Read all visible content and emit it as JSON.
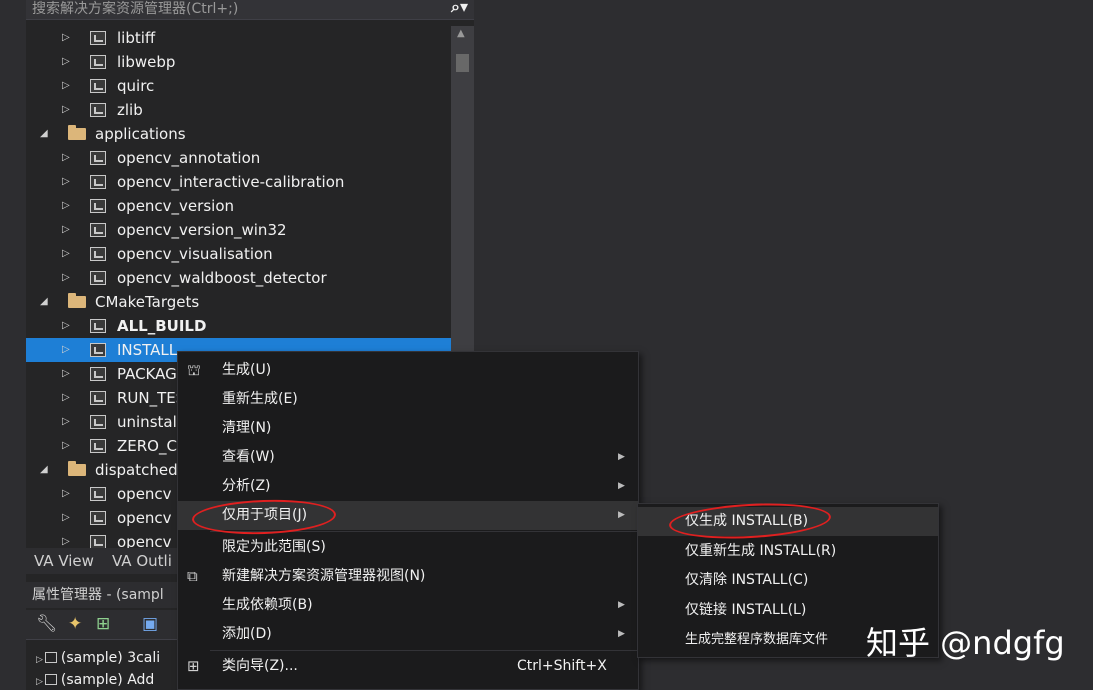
{
  "search": {
    "placeholder": "搜索解决方案资源管理器(Ctrl+;)",
    "icon": "search-icon"
  },
  "tree": [
    {
      "label": "libtiff",
      "type": "project",
      "level": 1,
      "expanded": false
    },
    {
      "label": "libwebp",
      "type": "project",
      "level": 1,
      "expanded": false
    },
    {
      "label": "quirc",
      "type": "project",
      "level": 1,
      "expanded": false
    },
    {
      "label": "zlib",
      "type": "project",
      "level": 1,
      "expanded": false
    },
    {
      "label": "applications",
      "type": "folder",
      "level": 0,
      "expanded": true
    },
    {
      "label": "opencv_annotation",
      "type": "project",
      "level": 1,
      "expanded": false
    },
    {
      "label": "opencv_interactive-calibration",
      "type": "project",
      "level": 1,
      "expanded": false
    },
    {
      "label": "opencv_version",
      "type": "project",
      "level": 1,
      "expanded": false
    },
    {
      "label": "opencv_version_win32",
      "type": "project",
      "level": 1,
      "expanded": false
    },
    {
      "label": "opencv_visualisation",
      "type": "project",
      "level": 1,
      "expanded": false
    },
    {
      "label": "opencv_waldboost_detector",
      "type": "project",
      "level": 1,
      "expanded": false
    },
    {
      "label": "CMakeTargets",
      "type": "folder",
      "level": 0,
      "expanded": true
    },
    {
      "label": "ALL_BUILD",
      "type": "project",
      "level": 1,
      "expanded": false,
      "bold": true
    },
    {
      "label": "INSTALL",
      "type": "project",
      "level": 1,
      "expanded": false,
      "selected": true
    },
    {
      "label": "PACKAGE",
      "type": "project",
      "level": 1,
      "expanded": false
    },
    {
      "label": "RUN_TESTS",
      "type": "project",
      "level": 1,
      "expanded": false
    },
    {
      "label": "uninstall",
      "type": "project",
      "level": 1,
      "expanded": false
    },
    {
      "label": "ZERO_CHECK",
      "type": "project",
      "level": 1,
      "expanded": false
    },
    {
      "label": "dispatched",
      "type": "folder",
      "level": 0,
      "expanded": true
    },
    {
      "label": "opencv",
      "type": "project",
      "level": 1,
      "expanded": false
    },
    {
      "label": "opencv",
      "type": "project",
      "level": 1,
      "expanded": false
    },
    {
      "label": "opencv",
      "type": "project",
      "level": 1,
      "expanded": false
    }
  ],
  "bottom_tabs": [
    "VA View",
    "VA Outli"
  ],
  "property_manager": {
    "title": "属性管理器 - (sampl",
    "toolbar_icons": [
      "wrench-icon",
      "wand-icon",
      "add-sheet-icon",
      "save-icon"
    ],
    "rows": [
      "(sample) 3cali",
      "(sample) Add"
    ]
  },
  "context_menu": [
    {
      "label": "生成(U)",
      "icon": "build-icon",
      "submenu": false,
      "shortcut": ""
    },
    {
      "label": "重新生成(E)",
      "submenu": false,
      "shortcut": ""
    },
    {
      "label": "清理(N)",
      "submenu": false,
      "shortcut": ""
    },
    {
      "label": "查看(W)",
      "submenu": true,
      "shortcut": ""
    },
    {
      "label": "分析(Z)",
      "submenu": true,
      "shortcut": ""
    },
    {
      "label": "仅用于项目(J)",
      "submenu": true,
      "shortcut": "",
      "highlighted": true
    },
    {
      "label": "限定为此范围(S)",
      "submenu": false,
      "shortcut": ""
    },
    {
      "label": "新建解决方案资源管理器视图(N)",
      "icon": "new-view-icon",
      "submenu": false,
      "shortcut": ""
    },
    {
      "label": "生成依赖项(B)",
      "submenu": true,
      "shortcut": ""
    },
    {
      "label": "添加(D)",
      "submenu": true,
      "shortcut": ""
    },
    {
      "label": "类向导(Z)...",
      "icon": "class-wizard-icon",
      "submenu": false,
      "shortcut": "Ctrl+Shift+X"
    }
  ],
  "submenu": [
    {
      "label": "仅生成 INSTALL(B)",
      "highlighted": true
    },
    {
      "label": "仅重新生成 INSTALL(R)"
    },
    {
      "label": "仅清除 INSTALL(C)"
    },
    {
      "label": "仅链接 INSTALL(L)"
    },
    {
      "label": "生成完整程序数据库文件"
    }
  ],
  "watermark": "知乎 @ndgfg",
  "colors": {
    "selection": "#1e7fd6",
    "annotation": "#e02020",
    "background": "#2d2d30"
  }
}
